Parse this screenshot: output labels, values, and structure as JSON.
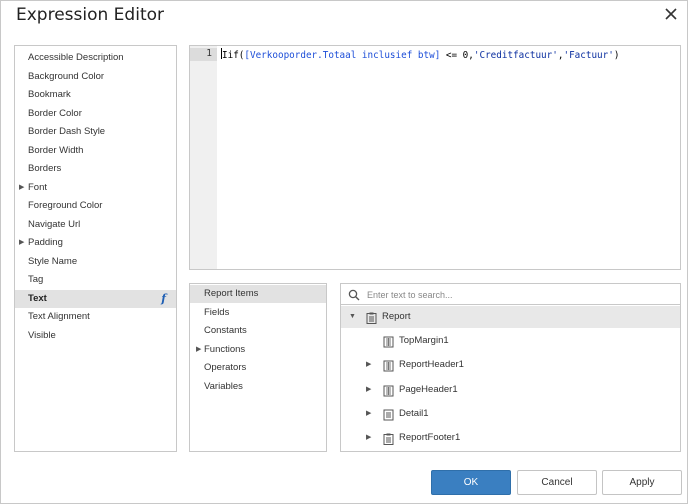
{
  "dialog": {
    "title": "Expression Editor"
  },
  "properties": [
    {
      "label": "Accessible Description",
      "expandable": false,
      "selected": false
    },
    {
      "label": "Background Color",
      "expandable": false,
      "selected": false
    },
    {
      "label": "Bookmark",
      "expandable": false,
      "selected": false
    },
    {
      "label": "Border Color",
      "expandable": false,
      "selected": false
    },
    {
      "label": "Border Dash Style",
      "expandable": false,
      "selected": false
    },
    {
      "label": "Border Width",
      "expandable": false,
      "selected": false
    },
    {
      "label": "Borders",
      "expandable": false,
      "selected": false
    },
    {
      "label": "Font",
      "expandable": true,
      "selected": false
    },
    {
      "label": "Foreground Color",
      "expandable": false,
      "selected": false
    },
    {
      "label": "Navigate Url",
      "expandable": false,
      "selected": false
    },
    {
      "label": "Padding",
      "expandable": true,
      "selected": false
    },
    {
      "label": "Style Name",
      "expandable": false,
      "selected": false
    },
    {
      "label": "Tag",
      "expandable": false,
      "selected": false
    },
    {
      "label": "Text",
      "expandable": false,
      "selected": true
    },
    {
      "label": "Text Alignment",
      "expandable": false,
      "selected": false
    },
    {
      "label": "Visible",
      "expandable": false,
      "selected": false
    }
  ],
  "editor": {
    "line_number": "1",
    "code": {
      "t1": "Iif(",
      "t2": "[Verkooporder.Totaal inclusief btw]",
      "t3": " <= 0,",
      "t4": "'Creditfactuur'",
      "t5": ",",
      "t6": "'Factuur'",
      "t7": ")"
    }
  },
  "categories": [
    {
      "label": "Report Items",
      "expandable": false,
      "selected": true
    },
    {
      "label": "Fields",
      "expandable": false,
      "selected": false
    },
    {
      "label": "Constants",
      "expandable": false,
      "selected": false
    },
    {
      "label": "Functions",
      "expandable": true,
      "selected": false
    },
    {
      "label": "Operators",
      "expandable": false,
      "selected": false
    },
    {
      "label": "Variables",
      "expandable": false,
      "selected": false
    }
  ],
  "search": {
    "placeholder": "Enter text to search..."
  },
  "tree": [
    {
      "label": "Report",
      "toggle": "expanded",
      "icon": "report-icon",
      "selected": true,
      "level": 0
    },
    {
      "label": "TopMargin1",
      "toggle": "none",
      "icon": "band-icon",
      "selected": false,
      "level": 1
    },
    {
      "label": "ReportHeader1",
      "toggle": "collapsed",
      "icon": "band-icon",
      "selected": false,
      "level": 1
    },
    {
      "label": "PageHeader1",
      "toggle": "collapsed",
      "icon": "band-icon",
      "selected": false,
      "level": 1
    },
    {
      "label": "Detail1",
      "toggle": "collapsed",
      "icon": "detail-icon",
      "selected": false,
      "level": 1
    },
    {
      "label": "ReportFooter1",
      "toggle": "collapsed",
      "icon": "report-icon",
      "selected": false,
      "level": 1
    }
  ],
  "buttons": {
    "ok": "OK",
    "cancel": "Cancel",
    "apply": "Apply"
  },
  "colors": {
    "accent": "#3a7fc1",
    "field": "#1d4ed8",
    "selection": "#e2e2e2"
  }
}
